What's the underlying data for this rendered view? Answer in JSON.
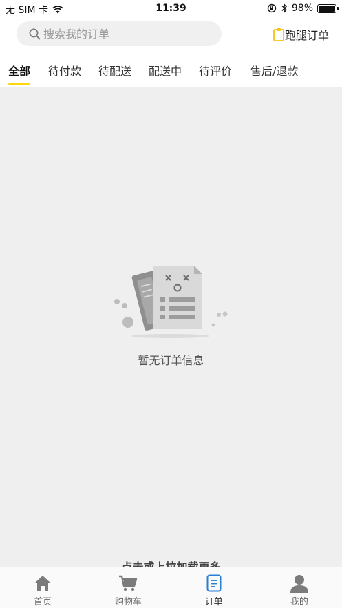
{
  "status_bar": {
    "carrier": "无 SIM 卡",
    "time": "11:39",
    "battery": "98%",
    "battery_level": 0.98,
    "icons": [
      "wifi-icon",
      "rotation-lock-icon",
      "bluetooth-icon",
      "battery-icon"
    ]
  },
  "search": {
    "placeholder": "搜索我的订单",
    "value": ""
  },
  "errand": {
    "label": "跑腿订单",
    "icon": "clipboard-icon",
    "icon_color": "#f5c518"
  },
  "tabs": [
    {
      "label": "全部",
      "active": true
    },
    {
      "label": "待付款",
      "active": false
    },
    {
      "label": "待配送",
      "active": false
    },
    {
      "label": "配送中",
      "active": false
    },
    {
      "label": "待评价",
      "active": false
    },
    {
      "label": "售后/退款",
      "active": false
    }
  ],
  "empty": {
    "message": "暂无订单信息",
    "icon": "empty-order-illustration"
  },
  "load_more": "点击或上拉加载更多",
  "bottom_nav": [
    {
      "label": "首页",
      "icon": "home-icon",
      "active": false
    },
    {
      "label": "购物车",
      "icon": "cart-icon",
      "active": false
    },
    {
      "label": "订单",
      "icon": "order-icon",
      "active": true
    },
    {
      "label": "我的",
      "icon": "user-icon",
      "active": false
    }
  ],
  "colors": {
    "accent": "#ffd60a",
    "active_nav": "#2a7fd4",
    "background": "#efefef"
  }
}
